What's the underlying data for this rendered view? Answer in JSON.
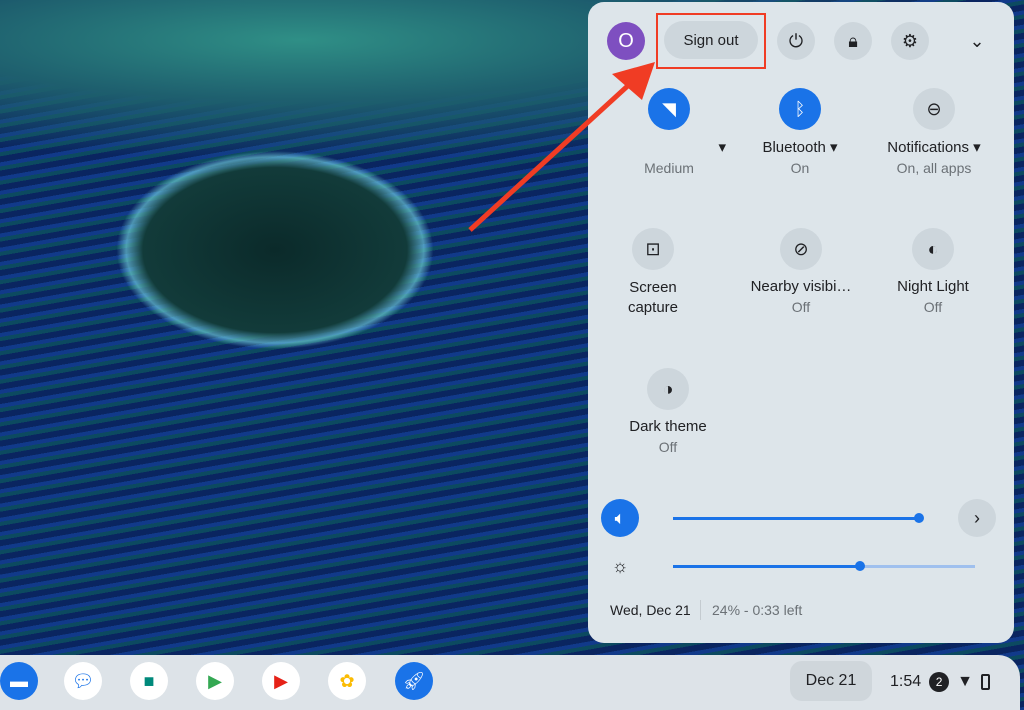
{
  "user": {
    "avatar_letter": "O"
  },
  "top": {
    "sign_out": "Sign out"
  },
  "tiles": [
    {
      "label": "",
      "sub": "Medium",
      "icon": "wifi-lock-icon",
      "on": true,
      "dropdown": true
    },
    {
      "label": "Bluetooth",
      "sub": "On",
      "icon": "bluetooth-icon",
      "on": true,
      "dropdown": true
    },
    {
      "label": "Notifications",
      "sub": "On, all apps",
      "icon": "do-not-disturb-icon",
      "on": false,
      "dropdown": true
    },
    {
      "label": "Screen capture",
      "sub": "",
      "icon": "screen-capture-icon",
      "on": false
    },
    {
      "label": "Nearby visibi…",
      "sub": "Off",
      "icon": "nearby-visibility-off-icon",
      "on": false
    },
    {
      "label": "Night Light",
      "sub": "Off",
      "icon": "night-light-icon",
      "on": false
    },
    {
      "label": "Dark theme",
      "sub": "Off",
      "icon": "dark-theme-icon",
      "on": false
    }
  ],
  "sliders": {
    "volume_percent": 100,
    "brightness_percent": 62
  },
  "footer": {
    "date": "Wed, Dec 21",
    "battery": "24% - 0:33 left"
  },
  "shelf": {
    "date": "Dec 21",
    "time": "1:54",
    "notification_count": "2"
  },
  "colors": {
    "accent": "#1a73e8",
    "highlight": "#f03c24"
  }
}
